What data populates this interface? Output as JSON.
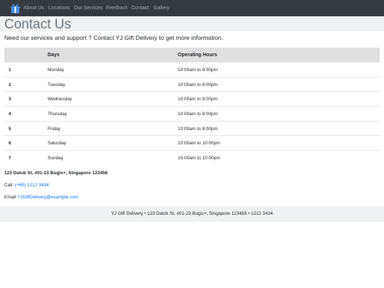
{
  "nav": {
    "logo_icon": "gift-icon",
    "brand_color": "#4a90e2",
    "items": [
      "About Us",
      "Locations",
      "Our Services",
      "Feedback",
      "Contact",
      "Gallery"
    ]
  },
  "page": {
    "title": "Contact Us",
    "intro": "Need our services and support ? Contact YJ Gift Delivery to get more information."
  },
  "hours_table": {
    "headers": [
      "",
      "Days",
      "Operating Hours"
    ],
    "rows": [
      {
        "num": "1",
        "day": "Monday",
        "hours": "10:00am to 8:00pm"
      },
      {
        "num": "2",
        "day": "Tuesday",
        "hours": "10:00am to 8:00pm"
      },
      {
        "num": "3",
        "day": "Wednesday",
        "hours": "10:00am to 8:00pm"
      },
      {
        "num": "4",
        "day": "Thursday",
        "hours": "10:00am to 8:00pm"
      },
      {
        "num": "5",
        "day": "Friday",
        "hours": "10:00am to 8:00pm"
      },
      {
        "num": "6",
        "day": "Saturday",
        "hours": "10:00am to 10:00pm"
      },
      {
        "num": "7",
        "day": "Sunday",
        "hours": "10:00am to 10:00pm"
      }
    ]
  },
  "contact": {
    "address": "123 Datuk St, #01-23 Bugis+, Singapore 123456",
    "call_label": "Call: ",
    "phone": "(+65) 1212 3434",
    "email_label": "Email:",
    "email": "YJGiftDelivery@example.com",
    "link_color": "#0d6efd"
  },
  "footer": {
    "text": "YJ Gift Delivery • 123 Datuk St, #01-23 Bugis+, Singapore 123456 • 1212 3434"
  }
}
